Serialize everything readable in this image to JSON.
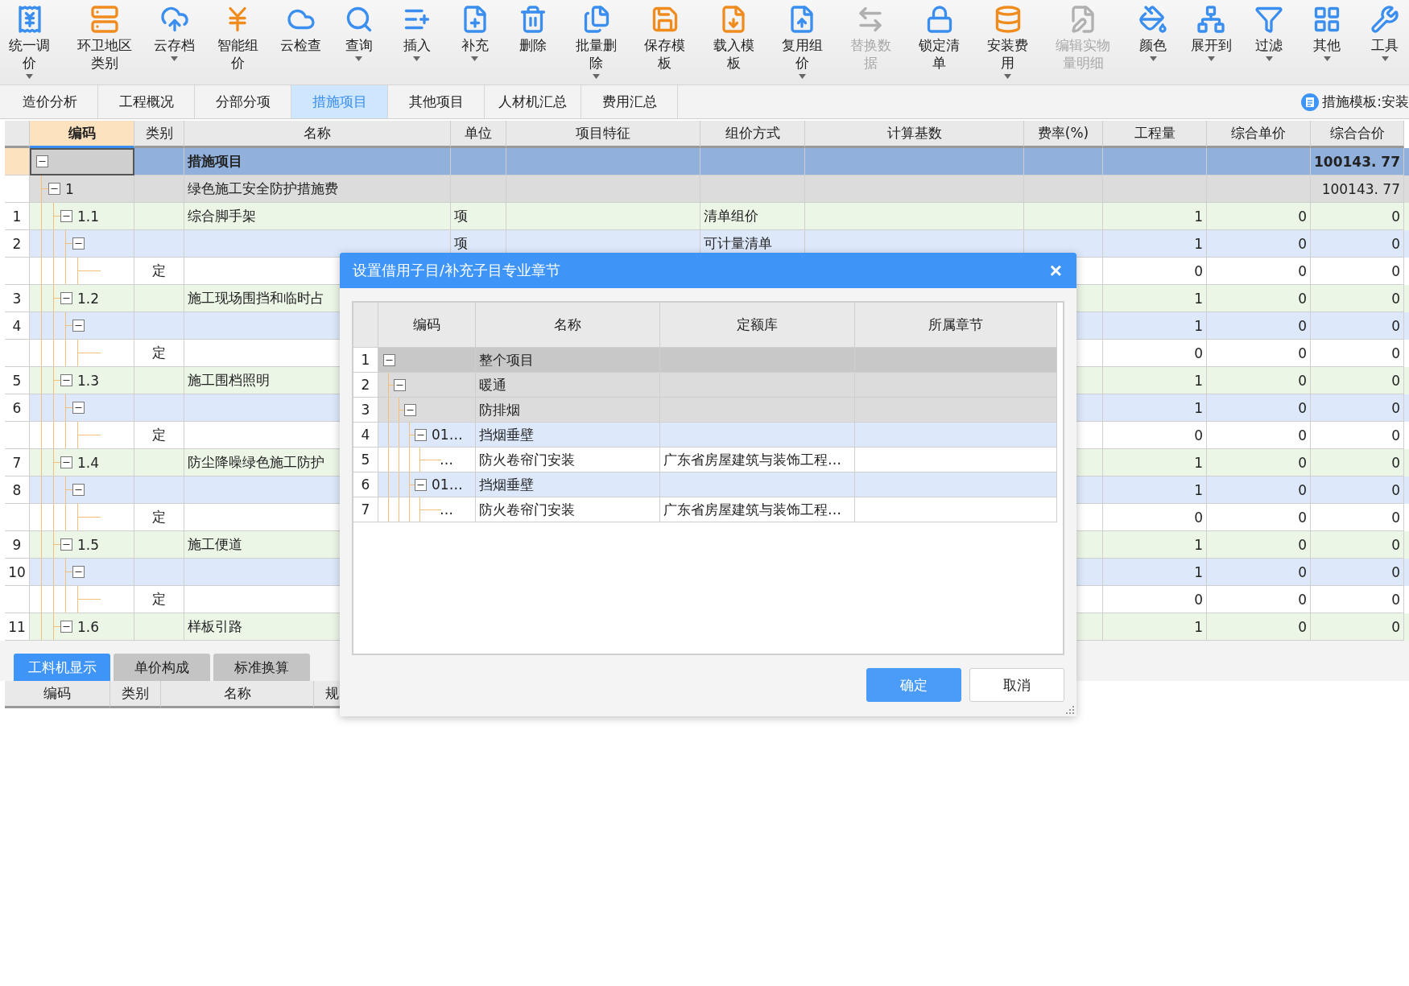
{
  "toolbar": {
    "items": [
      {
        "label": "统一调价",
        "caret": true,
        "disabled": false
      },
      {
        "label": "环卫地区类别",
        "caret": false,
        "disabled": false
      },
      {
        "label": "云存档",
        "caret": true,
        "disabled": false
      },
      {
        "label": "智能组价",
        "caret": false,
        "disabled": false
      },
      {
        "label": "云检查",
        "caret": false,
        "disabled": false
      },
      {
        "label": "查询",
        "caret": true,
        "disabled": false
      },
      {
        "label": "插入",
        "caret": true,
        "disabled": false
      },
      {
        "label": "补充",
        "caret": true,
        "disabled": false
      },
      {
        "label": "删除",
        "caret": false,
        "disabled": false
      },
      {
        "label": "批量删除",
        "caret": true,
        "disabled": false
      },
      {
        "label": "保存模板",
        "caret": false,
        "disabled": false
      },
      {
        "label": "载入模板",
        "caret": false,
        "disabled": false
      },
      {
        "label": "复用组价",
        "caret": true,
        "disabled": false
      },
      {
        "label": "替换数据",
        "caret": false,
        "disabled": true
      },
      {
        "label": "锁定清单",
        "caret": false,
        "disabled": false
      },
      {
        "label": "安装费用",
        "caret": true,
        "disabled": false
      },
      {
        "label": "编辑实物量明细",
        "caret": false,
        "disabled": true
      },
      {
        "label": "颜色",
        "caret": true,
        "disabled": false
      },
      {
        "label": "展开到",
        "caret": true,
        "disabled": false
      },
      {
        "label": "过滤",
        "caret": true,
        "disabled": false
      },
      {
        "label": "其他",
        "caret": true,
        "disabled": false
      },
      {
        "label": "工具",
        "caret": true,
        "disabled": false
      }
    ]
  },
  "tabs": [
    {
      "label": "造价分析",
      "selected": false
    },
    {
      "label": "工程概况",
      "selected": false
    },
    {
      "label": "分部分项",
      "selected": false
    },
    {
      "label": "措施项目",
      "selected": true
    },
    {
      "label": "其他项目",
      "selected": false
    },
    {
      "label": "人材机汇总",
      "selected": false
    },
    {
      "label": "费用汇总",
      "selected": false
    }
  ],
  "template_label": "措施模板:安装",
  "main_table": {
    "columns": [
      {
        "label": "编码",
        "selected": true
      },
      {
        "label": "类别",
        "selected": false
      },
      {
        "label": "名称",
        "selected": false
      },
      {
        "label": "单位",
        "selected": false
      },
      {
        "label": "项目特征",
        "selected": false
      },
      {
        "label": "组价方式",
        "selected": false
      },
      {
        "label": "计算基数",
        "selected": false
      },
      {
        "label": "费率(%)",
        "selected": false
      },
      {
        "label": "工程量",
        "selected": false
      },
      {
        "label": "综合单价",
        "selected": false
      },
      {
        "label": "综合合价",
        "selected": false
      }
    ],
    "rows": [
      {
        "name": "措施项目",
        "total": "100143. 77",
        "expanded": true,
        "selected": true,
        "children": [
          {
            "code": "1",
            "name": "绿色施工安全防护措施费",
            "total": "100143. 77",
            "expanded": true,
            "selected": false,
            "children": [
              {
                "row_no": "1",
                "code": "1.1",
                "name": "综合脚手架",
                "unit": "项",
                "method": "清单组价",
                "qty": "1",
                "price": "0",
                "total": "0",
                "expanded": true,
                "selected": false,
                "children": [
                  {
                    "row_no": "2",
                    "unit": "项",
                    "method": "可计量清单",
                    "qty": "1",
                    "price": "0",
                    "total": "0",
                    "expanded": true,
                    "selected": false,
                    "children": [
                      {
                        "category": "定",
                        "qty": "0",
                        "price": "0",
                        "total": "0",
                        "selected": false
                      }
                    ]
                  }
                ]
              },
              {
                "row_no": "3",
                "code": "1.2",
                "name": "施工现场围挡和临时占",
                "qty": "1",
                "price": "0",
                "total": "0",
                "expanded": true,
                "selected": false,
                "children": [
                  {
                    "row_no": "4",
                    "qty": "1",
                    "price": "0",
                    "total": "0",
                    "expanded": true,
                    "selected": false,
                    "children": [
                      {
                        "category": "定",
                        "qty": "0",
                        "price": "0",
                        "total": "0",
                        "selected": false
                      }
                    ]
                  }
                ]
              },
              {
                "row_no": "5",
                "code": "1.3",
                "name": "施工围档照明",
                "qty": "1",
                "price": "0",
                "total": "0",
                "expanded": true,
                "selected": false,
                "children": [
                  {
                    "row_no": "6",
                    "qty": "1",
                    "price": "0",
                    "total": "0",
                    "expanded": true,
                    "selected": false,
                    "children": [
                      {
                        "category": "定",
                        "qty": "0",
                        "price": "0",
                        "total": "0",
                        "selected": false
                      }
                    ]
                  }
                ]
              },
              {
                "row_no": "7",
                "code": "1.4",
                "name": "防尘降噪绿色施工防护",
                "qty": "1",
                "price": "0",
                "total": "0",
                "expanded": true,
                "selected": false,
                "children": [
                  {
                    "row_no": "8",
                    "qty": "1",
                    "price": "0",
                    "total": "0",
                    "expanded": true,
                    "selected": false,
                    "children": [
                      {
                        "category": "定",
                        "qty": "0",
                        "price": "0",
                        "total": "0",
                        "selected": false
                      }
                    ]
                  }
                ]
              },
              {
                "row_no": "9",
                "code": "1.5",
                "name": "施工便道",
                "qty": "1",
                "price": "0",
                "total": "0",
                "expanded": true,
                "selected": false,
                "children": [
                  {
                    "row_no": "10",
                    "qty": "1",
                    "price": "0",
                    "total": "0",
                    "expanded": true,
                    "selected": false,
                    "children": [
                      {
                        "category": "定",
                        "qty": "0",
                        "price": "0",
                        "total": "0",
                        "selected": false
                      }
                    ]
                  }
                ]
              },
              {
                "row_no": "11",
                "code": "1.6",
                "name": "样板引路",
                "qty": "1",
                "price": "0",
                "total": "0",
                "expanded": true,
                "selected": false
              }
            ]
          }
        ]
      }
    ]
  },
  "bottom_tabs": [
    {
      "label": "工料机显示",
      "selected": true
    },
    {
      "label": "单价构成",
      "selected": false
    },
    {
      "label": "标准换算",
      "selected": false
    }
  ],
  "bottom_table": {
    "columns": [
      "编码",
      "类别",
      "名称",
      "规"
    ]
  },
  "dialog": {
    "title": "设置借用子目/补充子目专业章节",
    "close": "×",
    "columns": [
      "编码",
      "名称",
      "定额库",
      "所属章节"
    ],
    "rows": [
      {
        "row_no": "1",
        "name": "整个项目",
        "expanded": true,
        "children": [
          {
            "row_no": "2",
            "name": "暖通",
            "expanded": true,
            "children": [
              {
                "row_no": "3",
                "name": "防排烟",
                "expanded": true,
                "children": [
                  {
                    "row_no": "4",
                    "code": "01…",
                    "name": "挡烟垂壁",
                    "expanded": true,
                    "children": [
                      {
                        "row_no": "5",
                        "code": "…",
                        "name": "防火卷帘门安装",
                        "library": "广东省房屋建筑与装饰工程…"
                      }
                    ]
                  },
                  {
                    "row_no": "6",
                    "code": "01…",
                    "name": "挡烟垂壁",
                    "expanded": true,
                    "children": [
                      {
                        "row_no": "7",
                        "code": "…",
                        "name": "防火卷帘门安装",
                        "library": "广东省房屋建筑与装饰工程…"
                      }
                    ]
                  }
                ]
              }
            ]
          }
        ]
      }
    ],
    "buttons": [
      {
        "label": "确定",
        "kind": "primary"
      },
      {
        "label": "取消",
        "kind": "default"
      }
    ]
  }
}
